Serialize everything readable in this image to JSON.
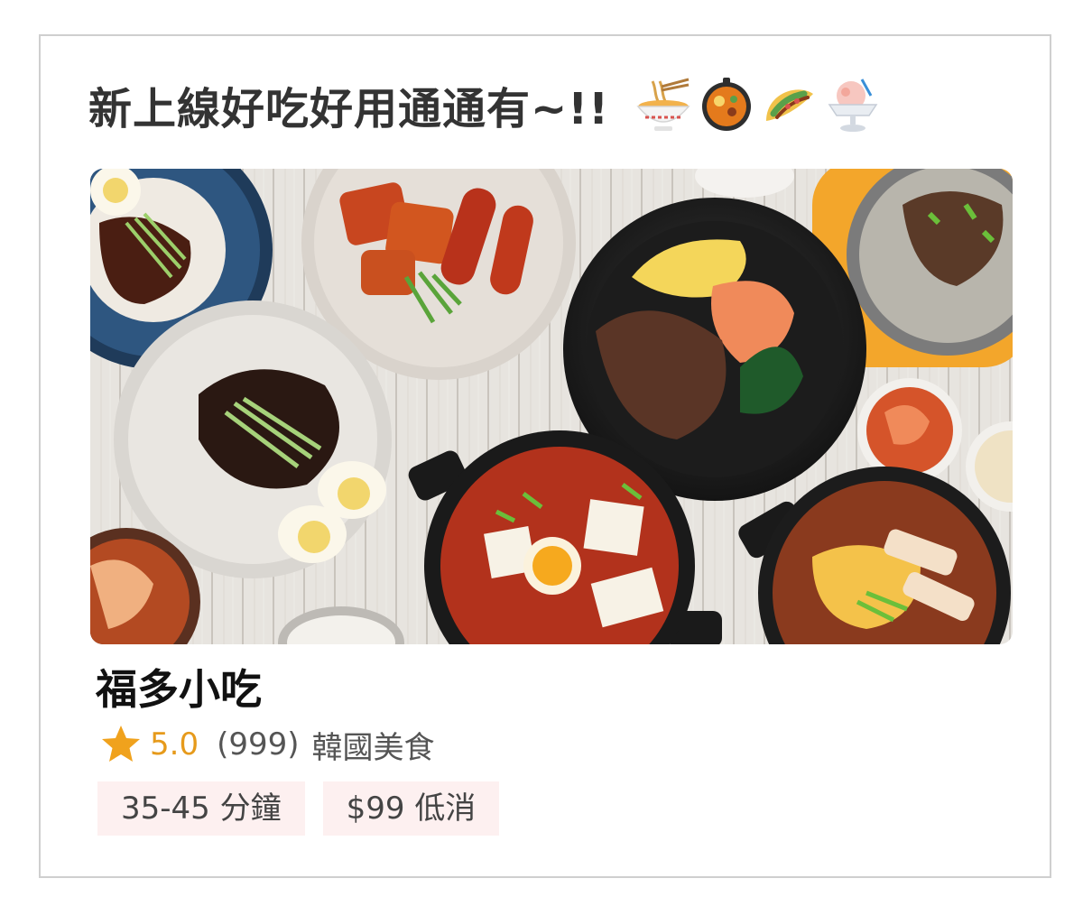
{
  "headline": {
    "text": "新上線好吃好用通通有~!!",
    "emoji_icons": [
      "ramen-bowl-icon",
      "hot-pot-icon",
      "taco-icon",
      "shaved-ice-icon"
    ]
  },
  "store": {
    "name": "福多小吃",
    "rating": "5.0",
    "review_count": "(999)",
    "category": "韓國美食",
    "tags": {
      "delivery_time": "35-45 分鐘",
      "min_order": "$99 低消"
    }
  },
  "colors": {
    "rating": "#e69a1b",
    "tag_bg": "#fdf0f0",
    "border": "#cfcfcf"
  }
}
